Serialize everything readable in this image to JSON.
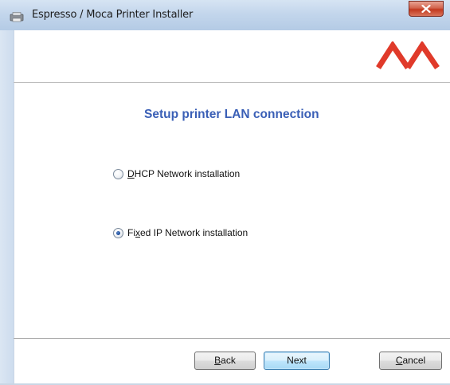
{
  "window": {
    "title": "Espresso / Moca Printer Installer",
    "close_icon": "close-x-icon"
  },
  "header": {
    "logo": "moca-logo",
    "logo_color": "#e03a2a"
  },
  "main": {
    "heading": "Setup printer LAN connection",
    "heading_color": "#3a5fb6",
    "options": [
      {
        "mnemonic": "D",
        "rest": "HCP Network installation",
        "selected": false
      },
      {
        "prefix": "Fi",
        "mnemonic": "x",
        "rest": "ed IP Network installation",
        "selected": true
      }
    ]
  },
  "footer": {
    "back": {
      "mnemonic": "B",
      "rest": "ack"
    },
    "next": {
      "label": "Next"
    },
    "cancel": {
      "mnemonic": "C",
      "rest": "ancel"
    }
  }
}
